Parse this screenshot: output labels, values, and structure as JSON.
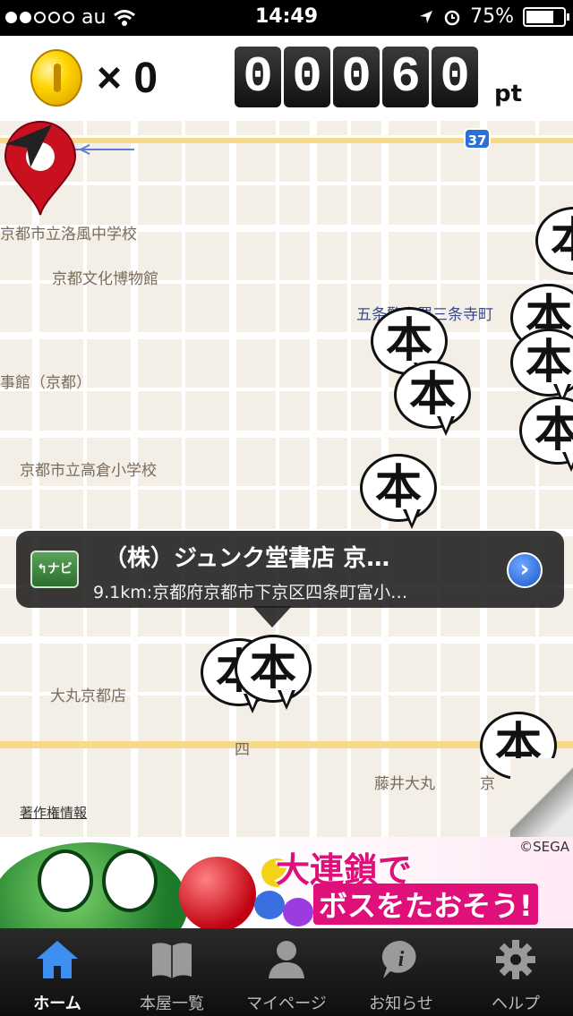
{
  "status_bar": {
    "carrier": "au",
    "time": "14:49",
    "battery": "75%",
    "battery_level": 0.75
  },
  "header": {
    "coin_label": "× 0",
    "score_digits": [
      "0",
      "0",
      "0",
      "6",
      "0"
    ],
    "score_unit": "pt"
  },
  "map": {
    "labels": {
      "school1": "京都市立洛風中学校",
      "museum": "京都文化博物館",
      "station": "五条警察署三条寺町",
      "consulate": "事館（京都）",
      "school2": "京都市立高倉小学校",
      "daimaru": "大丸京都店",
      "fujii": "藤井大丸",
      "kyo": "京",
      "yon": "四"
    },
    "route_number": "37",
    "marker_glyph": "本",
    "callout": {
      "navi_label": "ナビ",
      "title": "（株）ジュンク堂書店 京…",
      "subtitle": "9.1km:京都府京都市下京区四条町富小…"
    },
    "copyright": "著作権情報"
  },
  "ad": {
    "line1": "大連鎖で",
    "line2": "ボスをたおそう!",
    "credit": "©SEGA"
  },
  "tabbar": {
    "tabs": [
      {
        "label": "ホーム",
        "icon": "home-icon",
        "active": true
      },
      {
        "label": "本屋一覧",
        "icon": "book-icon",
        "active": false
      },
      {
        "label": "マイページ",
        "icon": "person-icon",
        "active": false
      },
      {
        "label": "お知らせ",
        "icon": "info-icon",
        "active": false
      },
      {
        "label": "ヘルプ",
        "icon": "gear-icon",
        "active": false
      }
    ]
  },
  "colors": {
    "tab_active": "#3f8ff0",
    "pin_red": "#c8101f",
    "callout_bg": "#1e1e1e"
  }
}
